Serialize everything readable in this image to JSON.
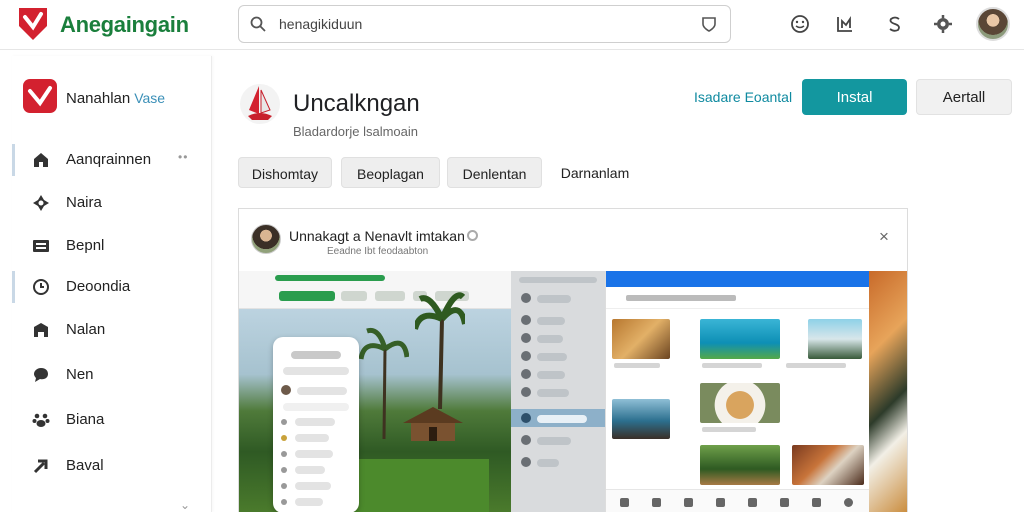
{
  "topbar": {
    "brand": "Anegaingain",
    "search_value": "henagikiduun",
    "icons": [
      "smile-icon",
      "bag-icon",
      "dollar-icon",
      "settings-icon"
    ]
  },
  "sidebar": {
    "title": "Nanahlan",
    "subtitle": "Vase",
    "items": [
      {
        "label": "Aanqrainnen",
        "icon": "home-icon"
      },
      {
        "label": "Naira",
        "icon": "grid-icon"
      },
      {
        "label": "Bepnl",
        "icon": "list-icon"
      },
      {
        "label": "Deoondia",
        "icon": "clock-icon"
      },
      {
        "label": "Nalan",
        "icon": "building-icon"
      },
      {
        "label": "Nen",
        "icon": "chat-icon"
      },
      {
        "label": "Biana",
        "icon": "paw-icon"
      },
      {
        "label": "Baval",
        "icon": "arrow-icon"
      }
    ]
  },
  "app": {
    "title": "Uncalkngan",
    "subtitle": "Bladardorje lsalmoain",
    "link_label": "Isadare Eoantal",
    "install_label": "Instal",
    "secondary_label": "Aertall",
    "tabs": [
      "Dishomtay",
      "Beoplagan",
      "Denlentan",
      "Darnanlam"
    ]
  },
  "preview": {
    "title": "Unnakagt a Nenavlt imtakan",
    "subtitle": "Eeadne Ibt feodaabton",
    "close": "×"
  },
  "colors": {
    "brand_green": "#1a7f3c",
    "accent_teal": "#13979f",
    "logo_red": "#d3212f"
  }
}
